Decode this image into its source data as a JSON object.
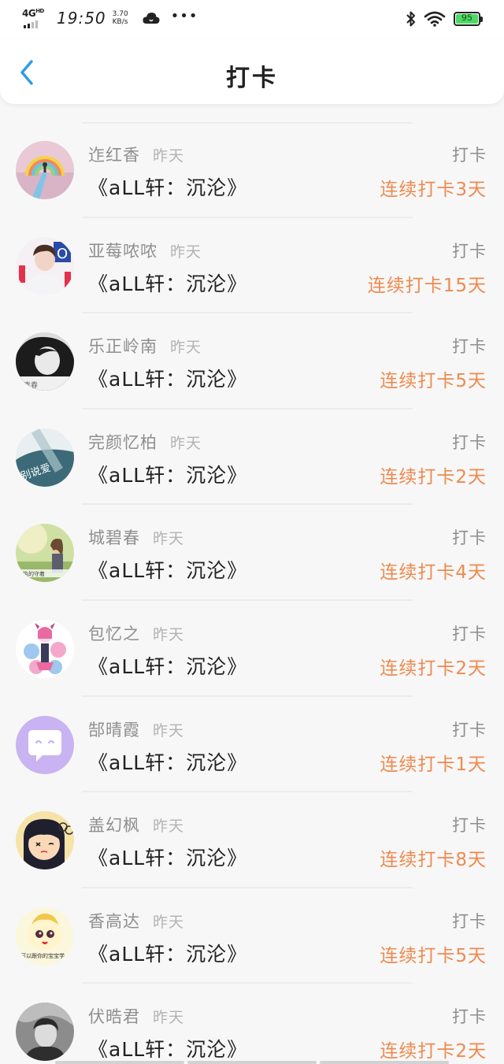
{
  "status_bar": {
    "network": "4G",
    "network_sup": "HD",
    "time": "19:50",
    "speed_value": "3.70",
    "speed_unit": "KB/s",
    "more": "•••",
    "battery": "95"
  },
  "header": {
    "title": "打卡"
  },
  "checkins": [
    {
      "name": "迮红香",
      "time": "昨天",
      "action": "打卡",
      "book": "《aLL轩：沉沦》",
      "streak": "连续打卡3天",
      "avatar": "rainbow"
    },
    {
      "name": "亚莓哝哝",
      "time": "昨天",
      "action": "打卡",
      "book": "《aLL轩：沉沦》",
      "streak": "连续打卡15天",
      "avatar": "person-pink"
    },
    {
      "name": "乐正岭南",
      "time": "昨天",
      "action": "打卡",
      "book": "《aLL轩：沉沦》",
      "streak": "连续打卡5天",
      "avatar": "girl-bw"
    },
    {
      "name": "完颜忆柏",
      "time": "昨天",
      "action": "打卡",
      "book": "《aLL轩：沉沦》",
      "streak": "连续打卡2天",
      "avatar": "teal-text"
    },
    {
      "name": "城碧春",
      "time": "昨天",
      "action": "打卡",
      "book": "《aLL轩：沉沦》",
      "streak": "连续打卡4天",
      "avatar": "field-girl"
    },
    {
      "name": "包忆之",
      "time": "昨天",
      "action": "打卡",
      "book": "《aLL轩：沉沦》",
      "streak": "连续打卡2天",
      "avatar": "anime-flowers"
    },
    {
      "name": "郜晴霞",
      "time": "昨天",
      "action": "打卡",
      "book": "《aLL轩：沉沦》",
      "streak": "连续打卡1天",
      "avatar": "purple-chat"
    },
    {
      "name": "盖幻枫",
      "time": "昨天",
      "action": "打卡",
      "book": "《aLL轩：沉沦》",
      "streak": "连续打卡8天",
      "avatar": "cartoon-girl"
    },
    {
      "name": "香高达",
      "time": "昨天",
      "action": "打卡",
      "book": "《aLL轩：沉沦》",
      "streak": "连续打卡5天",
      "avatar": "yellow-bun"
    },
    {
      "name": "伏晧君",
      "time": "昨天",
      "action": "打卡",
      "book": "《aLL轩：沉沦》",
      "streak": "连续打卡2天",
      "avatar": "bw-portrait"
    }
  ],
  "colors": {
    "accent_blue": "#2d9be8",
    "streak_orange": "#ee8a4e",
    "muted_text": "#8e8e8e"
  }
}
